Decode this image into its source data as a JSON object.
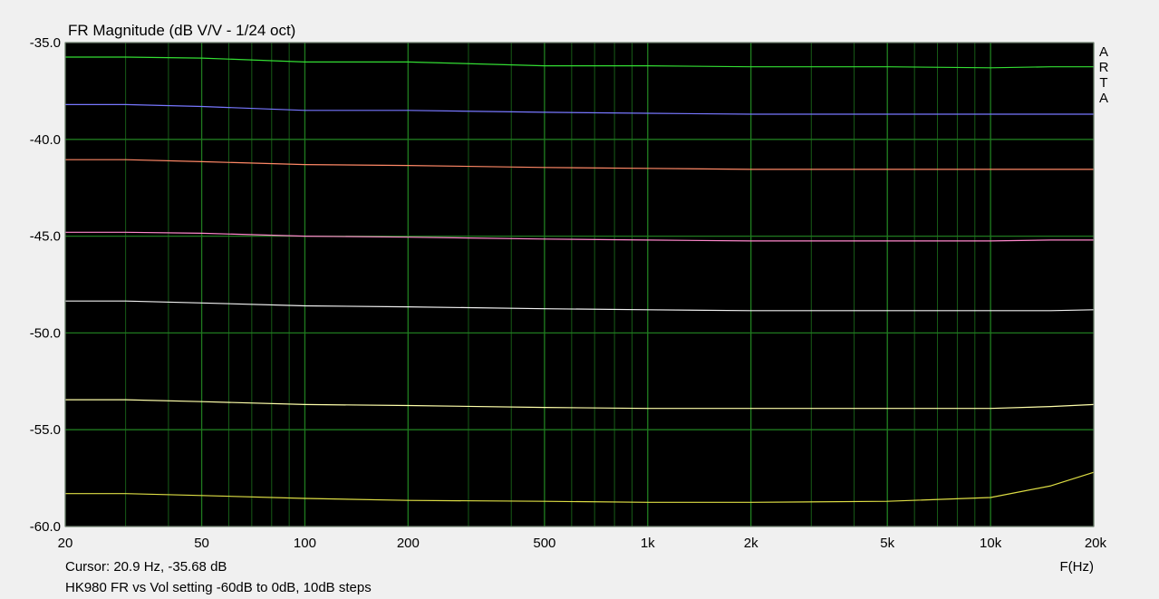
{
  "chart_data": {
    "type": "line",
    "title": "FR Magnitude (dB V/V - 1/24 oct)",
    "xlabel": "F(Hz)",
    "ylabel": "",
    "x_scale": "log",
    "xlim": [
      20,
      20000
    ],
    "ylim": [
      -60,
      -35
    ],
    "grid": true,
    "background": "#000000",
    "grid_color": "#1f7a1f",
    "y_ticks": [
      {
        "value": -35,
        "label": "-35.0"
      },
      {
        "value": -40,
        "label": "-40.0"
      },
      {
        "value": -45,
        "label": "-45.0"
      },
      {
        "value": -50,
        "label": "-50.0"
      },
      {
        "value": -55,
        "label": "-55.0"
      },
      {
        "value": -60,
        "label": "-60.0"
      }
    ],
    "x_ticks": [
      {
        "value": 20,
        "label": "20"
      },
      {
        "value": 50,
        "label": "50"
      },
      {
        "value": 100,
        "label": "100"
      },
      {
        "value": 200,
        "label": "200"
      },
      {
        "value": 500,
        "label": "500"
      },
      {
        "value": 1000,
        "label": "1k"
      },
      {
        "value": 2000,
        "label": "2k"
      },
      {
        "value": 5000,
        "label": "5k"
      },
      {
        "value": 10000,
        "label": "10k"
      },
      {
        "value": 20000,
        "label": "20k"
      }
    ],
    "x": [
      20,
      30,
      50,
      100,
      200,
      500,
      1000,
      2000,
      5000,
      10000,
      15000,
      20000
    ],
    "series": [
      {
        "color": "#33dd33",
        "values": [
          -35.75,
          -35.75,
          -35.8,
          -36.0,
          -36.0,
          -36.2,
          -36.2,
          -36.25,
          -36.25,
          -36.3,
          -36.25,
          -36.25
        ]
      },
      {
        "color": "#7777ff",
        "values": [
          -38.2,
          -38.2,
          -38.3,
          -38.5,
          -38.5,
          -38.6,
          -38.65,
          -38.7,
          -38.7,
          -38.7,
          -38.7,
          -38.7
        ]
      },
      {
        "color": "#ff8866",
        "values": [
          -41.05,
          -41.05,
          -41.15,
          -41.3,
          -41.35,
          -41.45,
          -41.5,
          -41.55,
          -41.55,
          -41.55,
          -41.55,
          -41.55
        ]
      },
      {
        "color": "#ff88cc",
        "values": [
          -44.8,
          -44.8,
          -44.85,
          -45.0,
          -45.05,
          -45.15,
          -45.2,
          -45.25,
          -45.25,
          -45.25,
          -45.2,
          -45.2
        ]
      },
      {
        "color": "#f0f0f0",
        "values": [
          -48.35,
          -48.35,
          -48.45,
          -48.6,
          -48.65,
          -48.75,
          -48.8,
          -48.85,
          -48.85,
          -48.85,
          -48.85,
          -48.8
        ]
      },
      {
        "color": "#ffffaa",
        "values": [
          -53.45,
          -53.45,
          -53.55,
          -53.7,
          -53.75,
          -53.85,
          -53.9,
          -53.9,
          -53.9,
          -53.9,
          -53.8,
          -53.7
        ]
      },
      {
        "color": "#dddd44",
        "values": [
          -58.3,
          -58.3,
          -58.4,
          -58.55,
          -58.65,
          -58.7,
          -58.75,
          -58.75,
          -58.7,
          -58.5,
          -57.9,
          -57.2
        ]
      }
    ]
  },
  "watermark": [
    "A",
    "R",
    "T",
    "A"
  ],
  "cursor_readout": "Cursor: 20.9 Hz, -35.68 dB",
  "caption": "HK980 FR vs Vol setting -60dB to 0dB, 10dB steps"
}
